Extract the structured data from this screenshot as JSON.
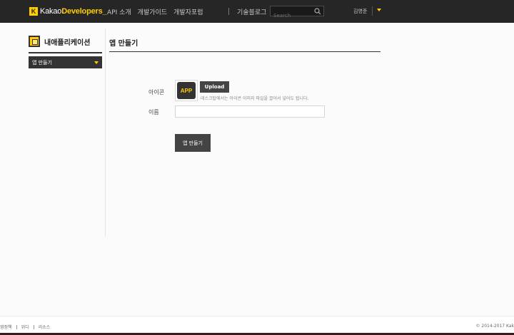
{
  "header": {
    "logo_k": "K",
    "logo_kakao": "Kakao",
    "logo_dev": "Developers_",
    "nav": [
      "API 소개",
      "개발가이드",
      "개발자포럼"
    ],
    "blog": "기술블로그",
    "search_placeholder": "Search",
    "user_name": "김영준"
  },
  "sidebar": {
    "title": "내애플리케이션",
    "selected": "앱 만들기"
  },
  "main": {
    "title": "앱 만들기",
    "icon_label": "아이콘",
    "app_thumb_text": "APP",
    "upload_label": "Upload",
    "upload_hint": "데스크탑에서는 아이콘 이미지 파일을 끌어서 넣어도 됩니다.",
    "name_label": "이름",
    "name_value": "",
    "create_label": "앱 만들기"
  },
  "footer": {
    "links": [
      "영정책",
      "위디",
      "리소스"
    ],
    "copyright": "© 2014-2017 Kak"
  },
  "colors": {
    "accent": "#ffcd00",
    "header_bg": "#262626",
    "button_bg": "#444444"
  }
}
